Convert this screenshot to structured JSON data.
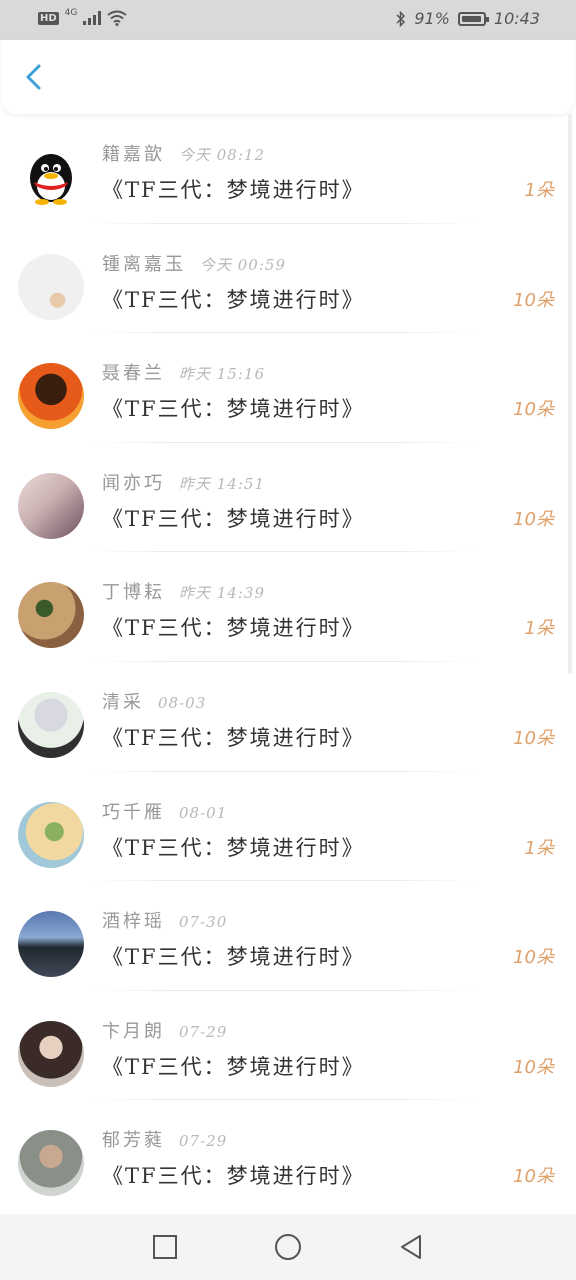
{
  "status_bar": {
    "hd": "HD",
    "network": "4G",
    "battery_percent": "91%",
    "time": "10:43"
  },
  "header": {
    "back_icon": "chevron-left-icon",
    "accent_color": "#3aa0d8"
  },
  "items": [
    {
      "name": "籍嘉歆",
      "time": "今天 08:12",
      "title": "《TF三代：梦境进行时》",
      "count": "1朵"
    },
    {
      "name": "锺离嘉玉",
      "time": "今天 00:59",
      "title": "《TF三代：梦境进行时》",
      "count": "10朵"
    },
    {
      "name": "聂春兰",
      "time": "昨天 15:16",
      "title": "《TF三代：梦境进行时》",
      "count": "10朵"
    },
    {
      "name": "闻亦巧",
      "time": "昨天 14:51",
      "title": "《TF三代：梦境进行时》",
      "count": "10朵"
    },
    {
      "name": "丁博耘",
      "time": "昨天 14:39",
      "title": "《TF三代：梦境进行时》",
      "count": "1朵"
    },
    {
      "name": "清采",
      "time": "08-03",
      "title": "《TF三代：梦境进行时》",
      "count": "10朵"
    },
    {
      "name": "巧千雁",
      "time": "08-01",
      "title": "《TF三代：梦境进行时》",
      "count": "1朵"
    },
    {
      "name": "酒梓瑶",
      "time": "07-30",
      "title": "《TF三代：梦境进行时》",
      "count": "10朵"
    },
    {
      "name": "卞月朗",
      "time": "07-29",
      "title": "《TF三代：梦境进行时》",
      "count": "10朵"
    },
    {
      "name": "郁芳蕤",
      "time": "07-29",
      "title": "《TF三代：梦境进行时》",
      "count": "10朵"
    }
  ],
  "colors": {
    "count": "#e0a06a",
    "name": "#999999",
    "title": "#333333"
  },
  "nav": {
    "recent_icon": "square-icon",
    "home_icon": "circle-icon",
    "back_icon": "triangle-back-icon"
  }
}
